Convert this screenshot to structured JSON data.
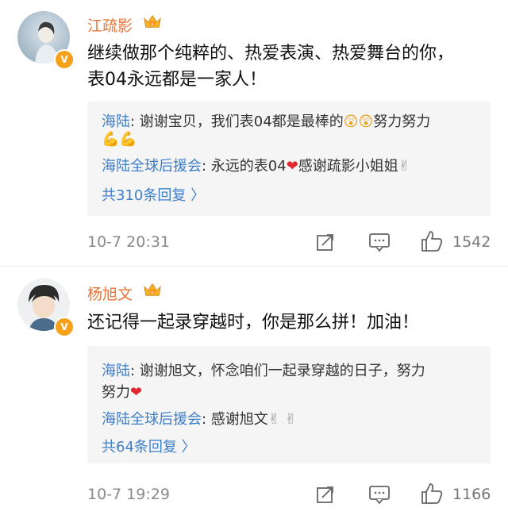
{
  "comments": [
    {
      "username": "江疏影",
      "text_line1": "继续做那个纯粹的、热爱表演、热爱舞台的你，",
      "text_line2": "表04永远都是一家人！",
      "replies": [
        {
          "name": "海陆",
          "sep": ": ",
          "text": "谢谢宝贝，我们表04都是最棒的",
          "text_after": "努力努力",
          "emoji_line": "💪💪"
        },
        {
          "name": "海陆全球后援会",
          "sep": ": ",
          "text": "永远的表04",
          "text_after": "感谢疏影小姐姐",
          "tail_emoji": "✌"
        }
      ],
      "more_replies": "共310条回复 〉",
      "timestamp": "10-7 20:31",
      "like_count": "1542",
      "verified_badge": "V"
    },
    {
      "username": "杨旭文",
      "text_line1": "还记得一起录穿越时，你是那么拼！加油！",
      "replies": [
        {
          "name": "海陆",
          "sep": ": ",
          "text": "谢谢旭文，怀念咱们一起录穿越的日子，努力",
          "text_line2": "努力"
        },
        {
          "name": "海陆全球后援会",
          "sep": ": ",
          "text": "感谢旭文",
          "tail_emoji": "✌ ✌"
        }
      ],
      "more_replies": "共64条回复 〉",
      "timestamp": "10-7 19:29",
      "like_count": "1166",
      "verified_badge": "V"
    }
  ],
  "colors": {
    "username": "#e8753a",
    "reply_name": "#3d7eca",
    "reply_bg": "#f5f5f5",
    "meta": "#8a8a8a",
    "badge": "#f7a11b",
    "heart": "#e3262d"
  },
  "icons": [
    "crown-badge-icon",
    "share-icon",
    "comment-icon",
    "like-icon",
    "verified-icon",
    "heart-icon"
  ]
}
